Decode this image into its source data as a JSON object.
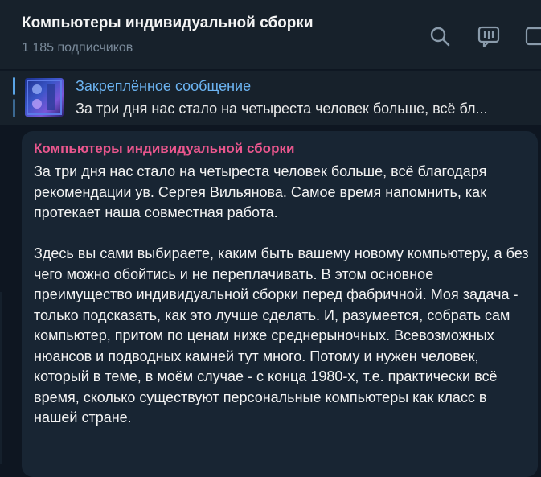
{
  "header": {
    "title": "Компьютеры индивидуальной сборки",
    "subscribers": "1 185 подписчиков",
    "icons": [
      "search-icon",
      "live-chat-icon",
      "sidebar-toggle-icon"
    ]
  },
  "pinned": {
    "label": "Закреплённое сообщение",
    "preview": "За три дня нас стало на четыреста человек больше, всё бл...",
    "thumbnail": "pinned-thumbnail"
  },
  "message": {
    "author": "Компьютеры индивидуальной сборки",
    "paragraph1": "За три дня нас стало на четыреста человек больше, всё благодаря рекомендации ув. Сергея Вильянова. Самое время напомнить, как протекает наша совместная работа.",
    "paragraph2": "Здесь вы сами выбираете, каким быть вашему новому компьютеру, а без чего можно обойтись и не переплачивать. В этом основное преимущество индивидуальной сборки перед фабричной. Моя задача - только подсказать, как это лучше сделать. И, разумеется, собрать сам компьютер, притом по ценам ниже среднерыночных. Всевозможных нюансов и подводных камней тут много. Потому и нужен человек, который в теме, в моём случае - с конца 1980-х, т.е. практически всё время, сколько существуют персональные компьютеры как класс в нашей стране."
  },
  "colors": {
    "background": "#0e1621",
    "header": "#17212b",
    "bubble": "#182533",
    "accent": "#6cb4f2",
    "author": "#e9568d"
  }
}
